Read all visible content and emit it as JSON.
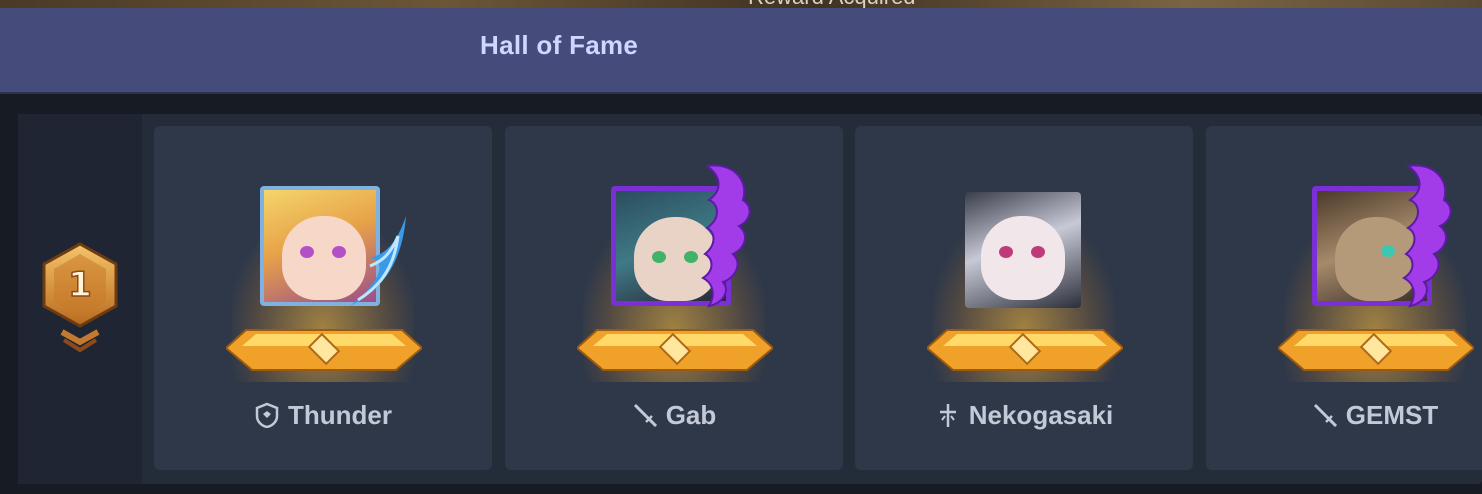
{
  "top_banner": {
    "text": "Reward Acquired"
  },
  "header": {
    "title": "Hall of Fame"
  },
  "rank": {
    "number": "1"
  },
  "entries": [
    {
      "name": "Thunder",
      "class_icon": "shield-icon",
      "frame": "gold-wing"
    },
    {
      "name": "Gab",
      "class_icon": "sword-icon",
      "frame": "purple-flame"
    },
    {
      "name": "Nekogasaki",
      "class_icon": "staff-icon",
      "frame": "none"
    },
    {
      "name": "GEMST",
      "class_icon": "sword-icon",
      "frame": "purple-flame"
    }
  ],
  "colors": {
    "header_bg": "#454c7c",
    "card_bg": "#2e3849",
    "rank_gold": "#e8a63a",
    "frame_purple": "#7b2fd6"
  }
}
